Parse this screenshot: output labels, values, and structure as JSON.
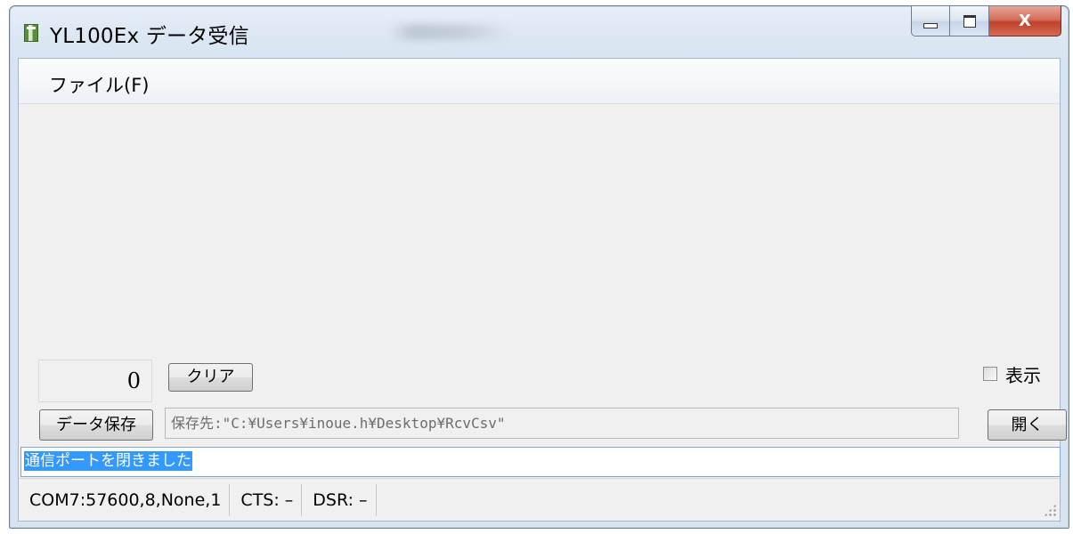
{
  "window": {
    "title": "YL100Ex データ受信"
  },
  "controls": {
    "minimize": "–",
    "close": "X"
  },
  "menu": {
    "file_label": "ファイル(F)"
  },
  "counter": {
    "value": "0"
  },
  "buttons": {
    "clear_label": "クリア",
    "save_label": "データ保存",
    "open_label": "開く"
  },
  "display_option": {
    "label": "表示",
    "checked": false
  },
  "save_path": {
    "text": "保存先:\"C:¥Users¥inoue.h¥Desktop¥RcvCsv\""
  },
  "log": {
    "message": "通信ポートを閉きました"
  },
  "status": {
    "port": "COM7:57600,8,None,1",
    "cts": "CTS: –",
    "dsr": "DSR: –"
  }
}
